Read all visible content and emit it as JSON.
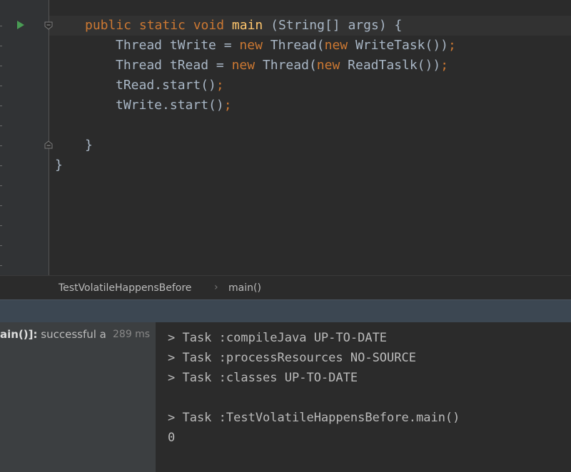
{
  "editor": {
    "lines": [
      {
        "parts": [
          {
            "t": "public static void ",
            "c": "kw"
          },
          {
            "t": "main",
            "c": "fn"
          },
          {
            "t": " (String[] args) {",
            "c": ""
          }
        ]
      },
      {
        "parts": [
          {
            "t": "Thread tWrite = ",
            "c": ""
          },
          {
            "t": "new ",
            "c": "kw"
          },
          {
            "t": "Thread(",
            "c": ""
          },
          {
            "t": "new ",
            "c": "kw"
          },
          {
            "t": "WriteTask())",
            "c": ""
          },
          {
            "t": ";",
            "c": "punc"
          }
        ]
      },
      {
        "parts": [
          {
            "t": "Thread tRead = ",
            "c": ""
          },
          {
            "t": "new ",
            "c": "kw"
          },
          {
            "t": "Thread(",
            "c": ""
          },
          {
            "t": "new ",
            "c": "kw"
          },
          {
            "t": "ReadTaslk())",
            "c": ""
          },
          {
            "t": ";",
            "c": "punc"
          }
        ]
      },
      {
        "parts": [
          {
            "t": "tRead.start()",
            "c": ""
          },
          {
            "t": ";",
            "c": "punc"
          }
        ]
      },
      {
        "parts": [
          {
            "t": "tWrite.start()",
            "c": ""
          },
          {
            "t": ";",
            "c": "punc"
          }
        ]
      },
      {
        "parts": [
          {
            "t": "}",
            "c": ""
          }
        ]
      },
      {
        "parts": [
          {
            "t": "}",
            "c": ""
          }
        ]
      }
    ],
    "colors": {
      "keyword": "#cc7832",
      "method": "#ffc66d",
      "text": "#a9b7c6",
      "run": "#499c54"
    }
  },
  "breadcrumb": {
    "class_name": "TestVolatileHappensBefore",
    "separator": "›",
    "method": "main()"
  },
  "run_tree": {
    "label_bold": "ain()]:",
    "label_status": " successful a",
    "time": "289 ms"
  },
  "console": {
    "lines": [
      "> Task :compileJava UP-TO-DATE",
      "> Task :processResources NO-SOURCE",
      "> Task :classes UP-TO-DATE",
      "",
      "> Task :TestVolatileHappensBefore.main()",
      "0"
    ]
  }
}
